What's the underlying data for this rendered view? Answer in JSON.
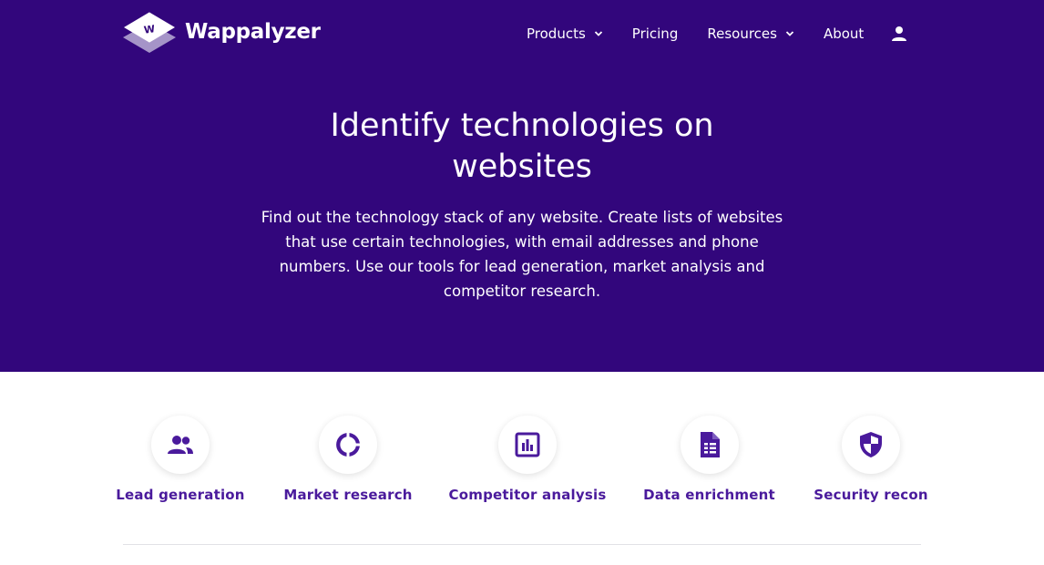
{
  "brand": {
    "name": "Wappalyzer",
    "mark_letter": "W"
  },
  "nav": {
    "products": "Products",
    "pricing": "Pricing",
    "resources": "Resources",
    "about": "About"
  },
  "hero": {
    "title_line1": "Identify technologies on",
    "title_line2": "websites",
    "sub_line1": "Find out the technology stack of any website. Create lists of websites",
    "sub_line2": "that use certain technologies, with email addresses and phone",
    "sub_line3": "numbers. Use our tools for lead generation, market analysis and",
    "sub_line4": "competitor research."
  },
  "features": [
    {
      "label": "Lead generation",
      "icon": "people-icon"
    },
    {
      "label": "Market research",
      "icon": "donut-icon"
    },
    {
      "label": "Competitor analysis",
      "icon": "bar-chart-icon"
    },
    {
      "label": "Data enrichment",
      "icon": "document-icon"
    },
    {
      "label": "Security recon",
      "icon": "shield-icon"
    }
  ],
  "colors": {
    "hero_bg": "#32067c",
    "accent": "#4a1a9c",
    "icon": "#4a1a9c"
  }
}
